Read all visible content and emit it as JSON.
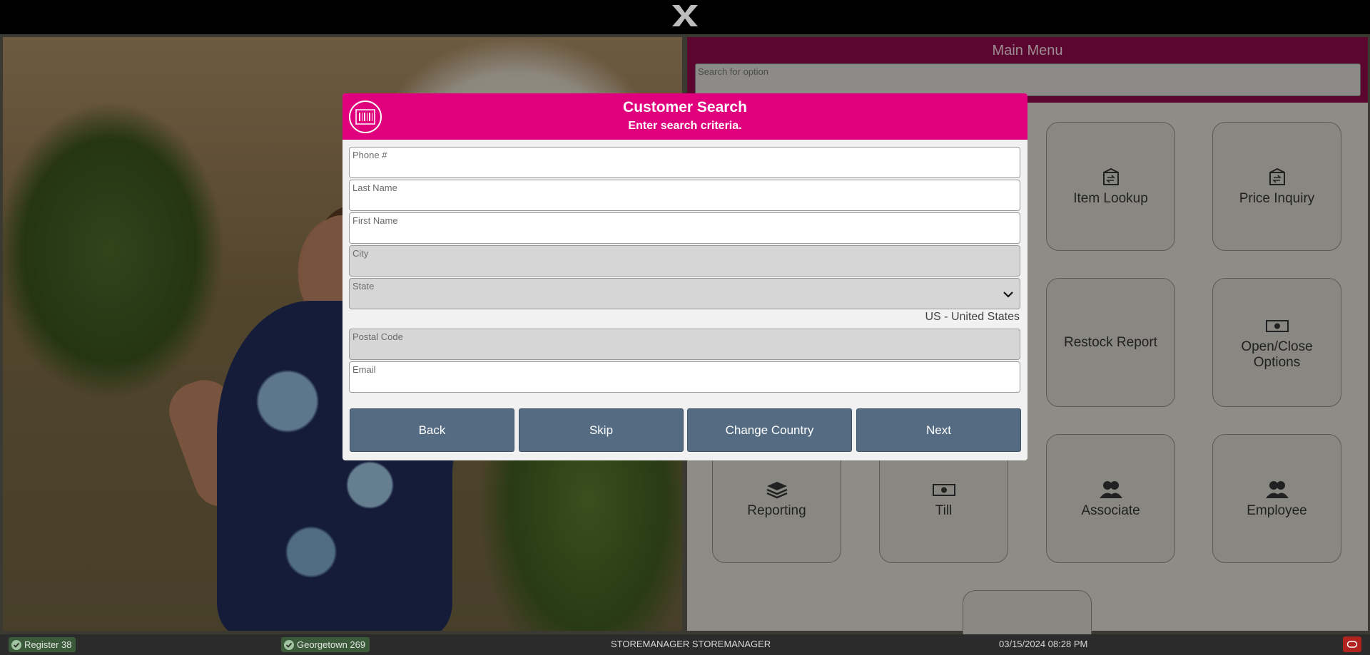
{
  "menu": {
    "title": "Main Menu",
    "search_placeholder": "Search for option",
    "tiles": [
      {
        "label": "Item Lookup",
        "icon": "box-arrows-icon"
      },
      {
        "label": "Price Inquiry",
        "icon": "box-arrows-icon"
      },
      {
        "label": "Restock Report",
        "icon": ""
      },
      {
        "label": "Open/Close Options",
        "icon": "cash-icon"
      },
      {
        "label": "Reporting",
        "icon": "layers-icon"
      },
      {
        "label": "Till",
        "icon": "cash-icon"
      },
      {
        "label": "Associate",
        "icon": "users-icon"
      },
      {
        "label": "Employee",
        "icon": "users-icon"
      }
    ]
  },
  "dialog": {
    "title": "Customer Search",
    "subtitle": "Enter search criteria.",
    "icon": "barcode-icon",
    "fields": {
      "phone": {
        "label": "Phone #",
        "value": "",
        "enabled": true
      },
      "last_name": {
        "label": "Last Name",
        "value": "",
        "enabled": true
      },
      "first_name": {
        "label": "First Name",
        "value": "",
        "enabled": true
      },
      "city": {
        "label": "City",
        "value": "",
        "enabled": false
      },
      "state": {
        "label": "State",
        "value": "",
        "enabled": false
      },
      "postal_code": {
        "label": "Postal Code",
        "value": "",
        "enabled": false
      },
      "email": {
        "label": "Email",
        "value": "",
        "enabled": true
      }
    },
    "country": "US - United States",
    "buttons": {
      "back": "Back",
      "skip": "Skip",
      "change_country": "Change Country",
      "next": "Next"
    }
  },
  "status": {
    "register": "Register 38",
    "store": "Georgetown 269",
    "user": "STOREMANAGER STOREMANAGER",
    "datetime": "03/15/2024 08:28 PM"
  },
  "colors": {
    "dialog_header": "#e0007e",
    "menu_header": "#8b0a48",
    "button": "#546b82",
    "status_ok": "#3a5a3a",
    "logout": "#b0231f"
  }
}
